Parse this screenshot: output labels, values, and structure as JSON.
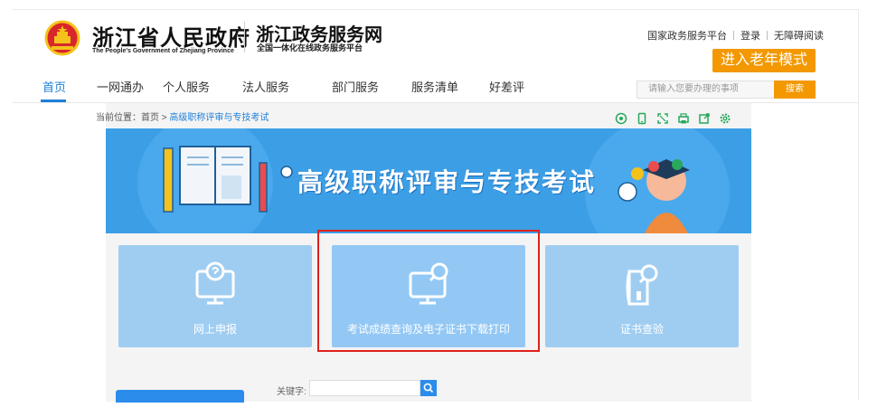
{
  "header": {
    "gov_name_cn": "浙江省人民政府",
    "gov_name_en": "The People's Government of Zhejiang Province",
    "service_title": "浙江政务服务网",
    "service_subtitle": "全国一体化在线政务服务平台",
    "top_links": [
      "国家政务服务平台",
      "登录",
      "无障碍阅读"
    ],
    "elder_mode_label": "进入老年模式"
  },
  "nav": {
    "items": [
      "首页",
      "一网通办",
      "个人服务",
      "法人服务",
      "部门服务",
      "服务清单",
      "好差评"
    ],
    "active_index": 0
  },
  "search": {
    "placeholder": "请输入您要办理的事项",
    "button_label": "搜索"
  },
  "breadcrumb": {
    "prefix": "当前位置：首页 > ",
    "current": "高级职称评审与专技考试"
  },
  "toolbar_icons": [
    "refresh-icon",
    "mobile-icon",
    "fullscreen-icon",
    "print-icon",
    "share-icon",
    "settings-icon"
  ],
  "banner": {
    "title": "高级职称评审与专技考试"
  },
  "cards": [
    {
      "label": "网上申报",
      "icon": "monitor-badge-icon"
    },
    {
      "label": "考试成绩查询及电子证书下载打印",
      "icon": "monitor-search-icon"
    },
    {
      "label": "证书查验",
      "icon": "certificate-search-icon"
    }
  ],
  "keyword": {
    "label": "关键字:",
    "value": ""
  },
  "colors": {
    "accent_blue": "#1e7fd8",
    "orange": "#f39800",
    "banner_blue": "#3c9fe6",
    "card_blue": "#9fcdf2",
    "highlight_red": "#e0201c"
  }
}
